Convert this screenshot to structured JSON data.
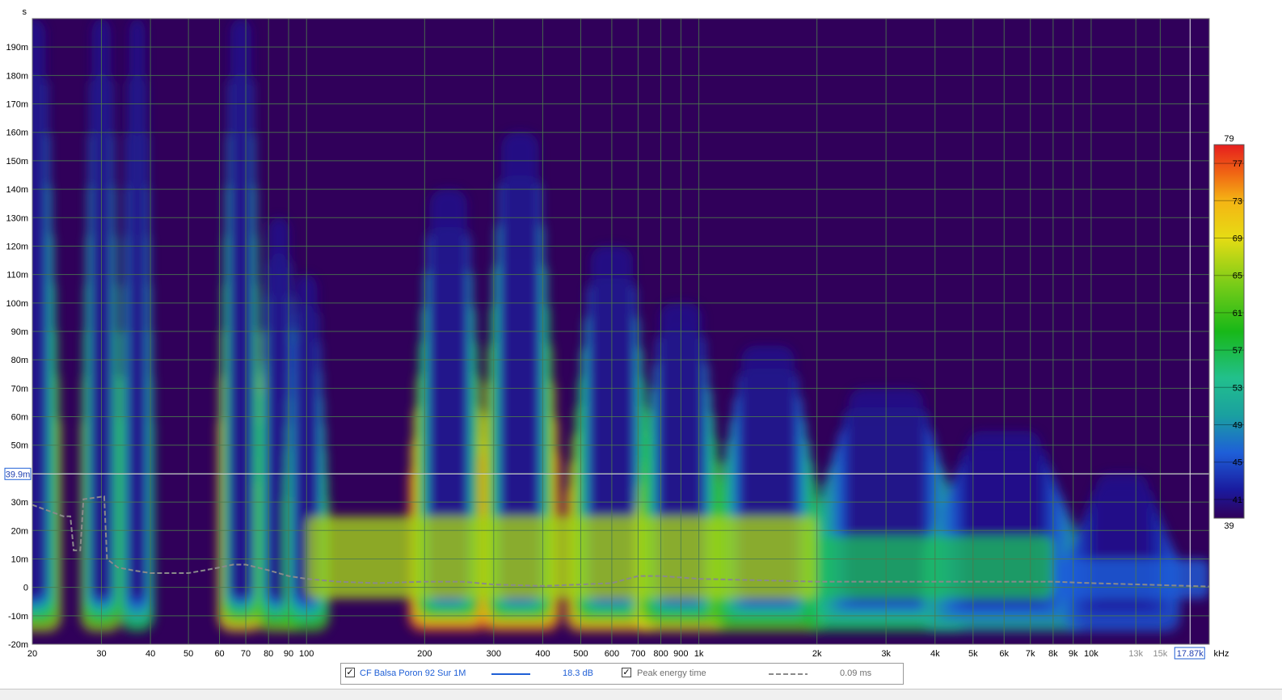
{
  "colors": {
    "background": "#30005a",
    "grid": "#4d7a4d",
    "axis_text": "#000000",
    "series_line": "#1f5fd6",
    "peak_line": "#8a8a8a",
    "cursor": "#e6e6e6",
    "legend_text_active": "#1f5fd6",
    "legend_text_inactive": "#6f6f6f"
  },
  "chart_data": {
    "type": "heatmap",
    "title": "",
    "x_scale": "log",
    "x_unit": "kHz",
    "y_unit": "s",
    "xlim": [
      20,
      20000
    ],
    "ylim": [
      -0.02,
      0.2
    ],
    "x_ticks": [
      20,
      30,
      40,
      50,
      60,
      70,
      80,
      90,
      100,
      200,
      300,
      400,
      500,
      600,
      700,
      800,
      900,
      1000,
      2000,
      3000,
      4000,
      5000,
      6000,
      7000,
      8000,
      9000,
      10000,
      13000,
      15000
    ],
    "x_tick_labels": [
      "20",
      "30",
      "40",
      "50",
      "60",
      "70",
      "80",
      "90",
      "100",
      "200",
      "300",
      "400",
      "500",
      "600",
      "700",
      "800",
      "900",
      "1k",
      "2k",
      "3k",
      "4k",
      "5k",
      "6k",
      "7k",
      "8k",
      "9k",
      "10k",
      "13k",
      "15k"
    ],
    "y_ticks": [
      -0.02,
      -0.01,
      0,
      0.01,
      0.02,
      0.03,
      0.04,
      0.05,
      0.06,
      0.07,
      0.08,
      0.09,
      0.1,
      0.11,
      0.12,
      0.13,
      0.14,
      0.15,
      0.16,
      0.17,
      0.18,
      0.19
    ],
    "y_tick_labels": [
      "-20m",
      "-10m",
      "0",
      "10m",
      "20m",
      "30m",
      "",
      "50m",
      "60m",
      "70m",
      "80m",
      "90m",
      "100m",
      "110m",
      "120m",
      "130m",
      "140m",
      "150m",
      "160m",
      "170m",
      "180m",
      "190m"
    ],
    "colorbar": {
      "range": [
        39,
        79
      ],
      "ticks": [
        79,
        77,
        73,
        69,
        65,
        61,
        57,
        53,
        49,
        45,
        41,
        39
      ],
      "stops": [
        {
          "value": 39,
          "color": "#30005a"
        },
        {
          "value": 42,
          "color": "#1a1a9e"
        },
        {
          "value": 46,
          "color": "#1e5fd8"
        },
        {
          "value": 50,
          "color": "#1aa0a0"
        },
        {
          "value": 54,
          "color": "#22c08c"
        },
        {
          "value": 59,
          "color": "#18b818"
        },
        {
          "value": 64,
          "color": "#78cc18"
        },
        {
          "value": 69,
          "color": "#e6dc14"
        },
        {
          "value": 73,
          "color": "#f5b414"
        },
        {
          "value": 76,
          "color": "#f06414"
        },
        {
          "value": 79,
          "color": "#e61e1e"
        }
      ]
    },
    "decay_regions": [
      {
        "f": 20,
        "level": 67,
        "t_top": 0.2,
        "width_oct": 0.25
      },
      {
        "f": 30,
        "level": 66,
        "t_top": 0.2,
        "width_oct": 0.18
      },
      {
        "f": 37,
        "level": 58,
        "t_top": 0.2,
        "width_oct": 0.15
      },
      {
        "f": 68,
        "level": 72,
        "t_top": 0.2,
        "width_oct": 0.2
      },
      {
        "f": 85,
        "level": 65,
        "t_top": 0.13,
        "width_oct": 0.2
      },
      {
        "f": 100,
        "level": 62,
        "t_top": 0.11,
        "width_oct": 0.2
      },
      {
        "f": 230,
        "level": 78,
        "t_top": 0.14,
        "width_oct": 0.35
      },
      {
        "f": 350,
        "level": 76,
        "t_top": 0.16,
        "width_oct": 0.35
      },
      {
        "f": 600,
        "level": 74,
        "t_top": 0.12,
        "width_oct": 0.4
      },
      {
        "f": 900,
        "level": 70,
        "t_top": 0.1,
        "width_oct": 0.4
      },
      {
        "f": 1500,
        "level": 64,
        "t_top": 0.085,
        "width_oct": 0.5
      },
      {
        "f": 3000,
        "level": 58,
        "t_top": 0.07,
        "width_oct": 0.7
      },
      {
        "f": 6000,
        "level": 52,
        "t_top": 0.055,
        "width_oct": 0.7
      },
      {
        "f": 12000,
        "level": 46,
        "t_top": 0.04,
        "width_oct": 0.5
      }
    ],
    "series": [
      {
        "name": "CF Balsa Poron 92 Sur 1M",
        "value_label": "18.3 dB",
        "style": "solid"
      },
      {
        "name": "Peak energy time",
        "value_label": "0.09 ms",
        "style": "dashed",
        "x": [
          20,
          24,
          25,
          25.5,
          26.5,
          27,
          30.5,
          31,
          33,
          36,
          40,
          45,
          50,
          55,
          60,
          65,
          70,
          80,
          90,
          100,
          120,
          150,
          200,
          250,
          300,
          400,
          500,
          600,
          700,
          800,
          1000,
          2000,
          3000,
          5000,
          8000,
          10000,
          15000,
          20000
        ],
        "y": [
          0.029,
          0.025,
          0.025,
          0.013,
          0.013,
          0.031,
          0.032,
          0.01,
          0.007,
          0.006,
          0.005,
          0.005,
          0.005,
          0.006,
          0.007,
          0.008,
          0.008,
          0.006,
          0.004,
          0.003,
          0.002,
          0.0015,
          0.002,
          0.002,
          0.001,
          0.0005,
          0.001,
          0.0015,
          0.004,
          0.004,
          0.003,
          0.002,
          0.002,
          0.002,
          0.002,
          0.0015,
          0.0008,
          0.0003
        ]
      }
    ],
    "cursor": {
      "x_label": "17.87k",
      "y_label": "39.9m"
    }
  },
  "legend": {
    "check_mark": "✓",
    "series1_name": "CF Balsa Poron 92 Sur 1M",
    "series1_value": "18.3 dB",
    "series2_name": "Peak energy time",
    "series2_value": "0.09 ms"
  }
}
